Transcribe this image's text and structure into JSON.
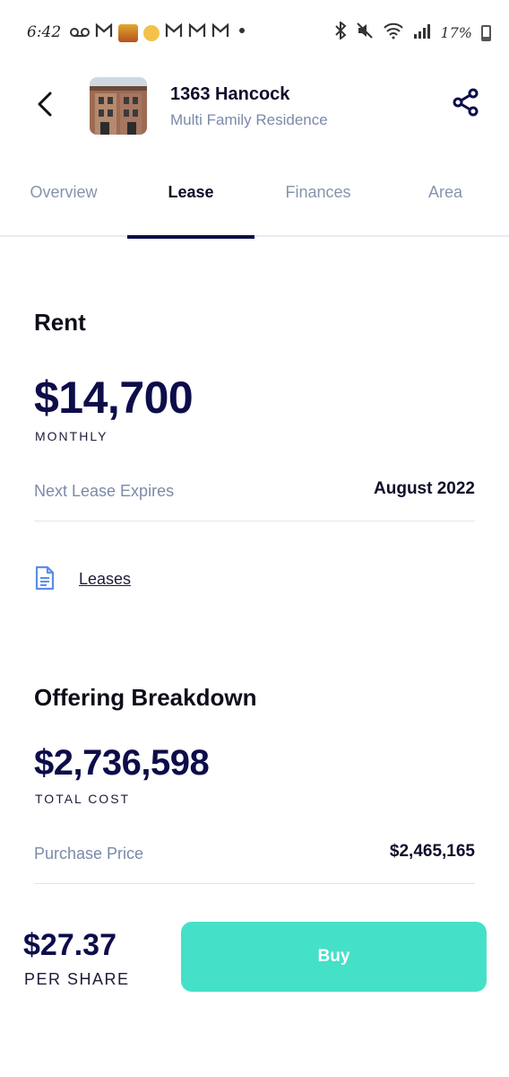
{
  "status_bar": {
    "time": "6:42",
    "battery": "17%",
    "left_icons": [
      "voicemail-icon",
      "gmail-icon",
      "app-thumb-icon",
      "face-emoji-icon",
      "gmail-icon",
      "gmail-icon",
      "gmail-icon",
      "dot-icon"
    ],
    "right_icons": [
      "bluetooth-icon",
      "mute-icon",
      "wifi-icon",
      "signal-icon",
      "battery-icon"
    ]
  },
  "header": {
    "title": "1363 Hancock",
    "subtitle": "Multi Family Residence"
  },
  "tabs": [
    {
      "label": "Overview",
      "active": false
    },
    {
      "label": "Lease",
      "active": true
    },
    {
      "label": "Finances",
      "active": false
    },
    {
      "label": "Area",
      "active": false
    }
  ],
  "rent": {
    "title": "Rent",
    "value": "$14,700",
    "caption": "MONTHLY",
    "next_lease_label": "Next Lease Expires",
    "next_lease_value": "August 2022",
    "leases_link": "Leases"
  },
  "offering": {
    "title": "Offering Breakdown",
    "value": "$2,736,598",
    "caption": "TOTAL COST",
    "purchase_label": "Purchase Price",
    "purchase_value": "$2,465,165"
  },
  "footer": {
    "price": "$27.37",
    "caption": "PER SHARE",
    "buy_label": "Buy"
  },
  "colors": {
    "accent": "#0d0d4a",
    "muted": "#7b8aa8",
    "buy": "#45e0c8",
    "doc_icon": "#5b8def"
  }
}
